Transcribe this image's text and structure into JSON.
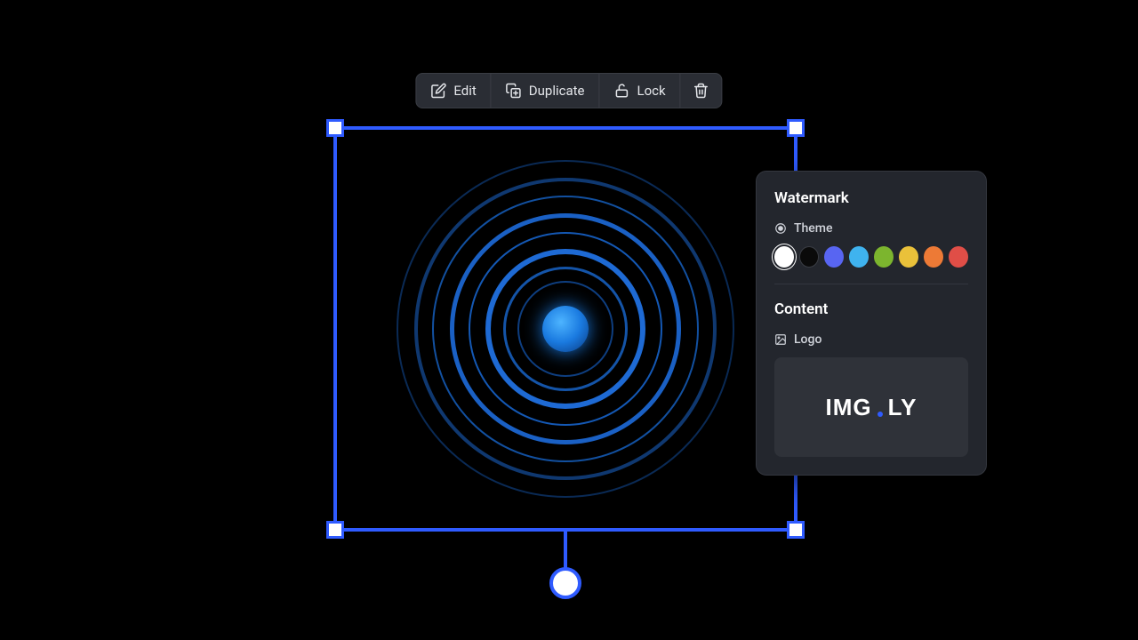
{
  "toolbar": {
    "edit": "Edit",
    "duplicate": "Duplicate",
    "lock": "Lock"
  },
  "panel": {
    "title": "Watermark",
    "theme_label": "Theme",
    "content_label": "Content",
    "logo_label": "Logo",
    "logo_text_a": "IMG",
    "logo_text_b": "LY",
    "swatches": [
      {
        "color": "#ffffff",
        "selected": true
      },
      {
        "color": "#0a0a0a",
        "selected": false
      },
      {
        "color": "#5865f2",
        "selected": false
      },
      {
        "color": "#3fb3ef",
        "selected": false
      },
      {
        "color": "#7cb52e",
        "selected": false
      },
      {
        "color": "#eac13a",
        "selected": false
      },
      {
        "color": "#ed7a36",
        "selected": false
      },
      {
        "color": "#e04e47",
        "selected": false
      }
    ]
  },
  "selection": {
    "accent": "#2f5bff"
  }
}
